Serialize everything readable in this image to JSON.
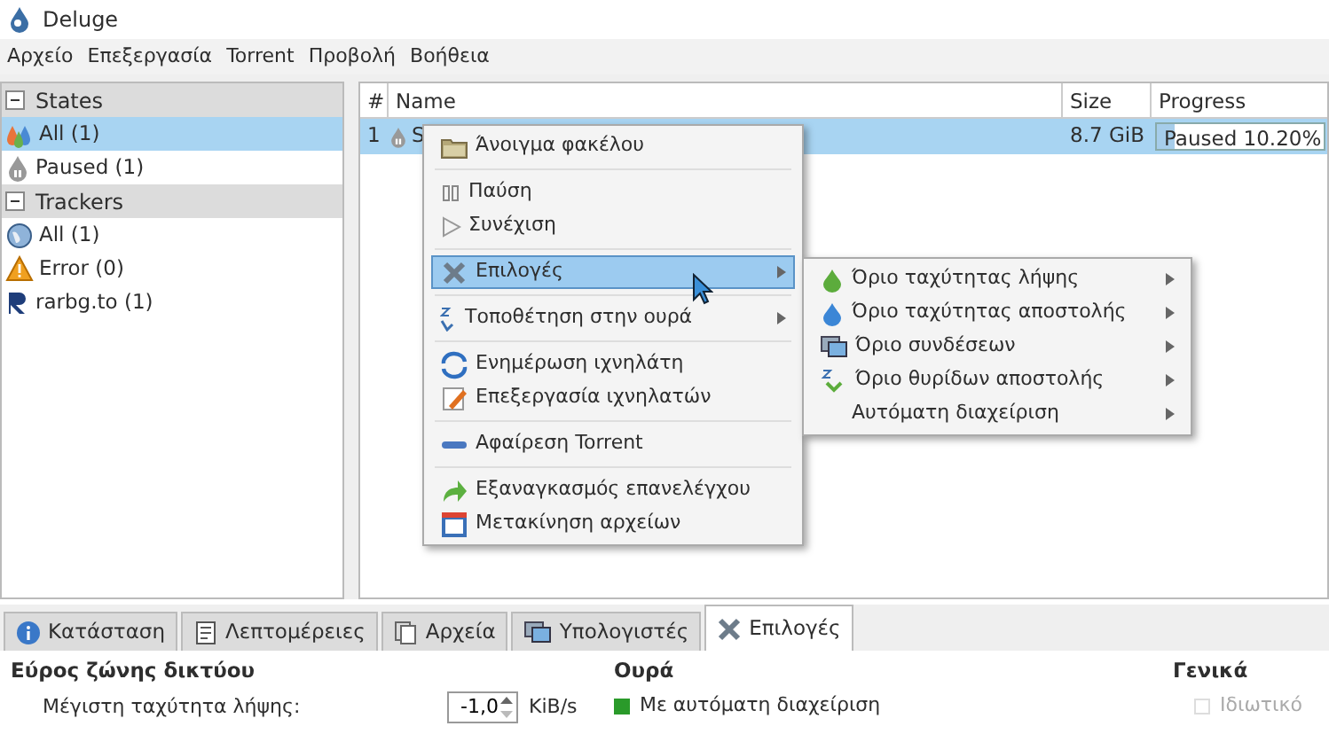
{
  "window": {
    "title": "Deluge"
  },
  "menu_bar": [
    "Αρχείο",
    "Επεξεργασία",
    "Torrent",
    "Προβολή",
    "Βοήθεια"
  ],
  "sidebar": {
    "groups": [
      {
        "title": "States",
        "expanded": true,
        "items": [
          {
            "label": "All (1)",
            "selected": true
          },
          {
            "label": "Paused (1)",
            "selected": false
          }
        ]
      },
      {
        "title": "Trackers",
        "expanded": true,
        "items": [
          {
            "label": "All (1)",
            "selected": false
          },
          {
            "label": "Error (0)",
            "selected": false
          },
          {
            "label": "rarbg.to (1)",
            "selected": false
          }
        ]
      }
    ]
  },
  "torrents": {
    "columns": [
      "#",
      "Name",
      "Size",
      "Progress"
    ],
    "rows": [
      {
        "number": "1",
        "name": "S",
        "size": "8.7 GiB",
        "progress": "Paused 10.20%",
        "level": 0.102,
        "selected": true
      }
    ]
  },
  "context_menu": {
    "items": [
      {
        "kind": "item",
        "label": "Άνοιγμα φακέλου",
        "submenu": false,
        "selected": false
      },
      {
        "kind": "separator"
      },
      {
        "kind": "item",
        "label": "Παύση",
        "submenu": false,
        "selected": false
      },
      {
        "kind": "item",
        "label": "Συνέχιση",
        "submenu": false,
        "selected": false
      },
      {
        "kind": "separator"
      },
      {
        "kind": "item",
        "label": "Επιλογές",
        "submenu": true,
        "selected": true
      },
      {
        "kind": "separator"
      },
      {
        "kind": "item",
        "label": "Τοποθέτηση στην ουρά",
        "submenu": true,
        "selected": false
      },
      {
        "kind": "separator"
      },
      {
        "kind": "item",
        "label": "Ενημέρωση ιχνηλάτη",
        "submenu": false,
        "selected": false
      },
      {
        "kind": "item",
        "label": "Επεξεργασία ιχνηλατών",
        "submenu": false,
        "selected": false
      },
      {
        "kind": "separator"
      },
      {
        "kind": "item",
        "label": "Αφαίρεση Torrent",
        "submenu": false,
        "selected": false
      },
      {
        "kind": "separator"
      },
      {
        "kind": "item",
        "label": "Εξαναγκασμός επανελέγχου",
        "submenu": false,
        "selected": false
      },
      {
        "kind": "item",
        "label": "Μετακίνηση αρχείων",
        "submenu": false,
        "selected": false
      }
    ]
  },
  "submenu": {
    "items": [
      {
        "label": "Όριο ταχύτητας λήψης",
        "submenu": true
      },
      {
        "label": "Όριο ταχύτητας αποστολής",
        "submenu": true
      },
      {
        "label": "Όριο συνδέσεων",
        "submenu": true
      },
      {
        "label": "Όριο θυρίδων αποστολής",
        "submenu": true
      },
      {
        "label": "Αυτόματη διαχείριση",
        "submenu": true
      }
    ]
  },
  "bottom_tabs": [
    {
      "label": "Κατάσταση",
      "selected": false
    },
    {
      "label": "Λεπτομέρειες",
      "selected": false
    },
    {
      "label": "Αρχεία",
      "selected": false
    },
    {
      "label": "Υπολογιστές",
      "selected": false
    },
    {
      "label": "Επιλογές",
      "selected": true
    }
  ],
  "options": {
    "bandwidth": {
      "title": "Εύρος ζώνης δικτύου",
      "label": "Μέγιστη ταχύτητα λήψης:",
      "value": "-1,0",
      "unit": "KiB/s"
    },
    "queue": {
      "title": "Ουρά",
      "checkbox": {
        "label": "Με αυτόματη διαχείριση",
        "checked": true,
        "disabled": false
      }
    },
    "general": {
      "title": "Γενικά",
      "checkbox": {
        "label": "Ιδιωτικό",
        "checked": false,
        "disabled": true
      }
    }
  }
}
